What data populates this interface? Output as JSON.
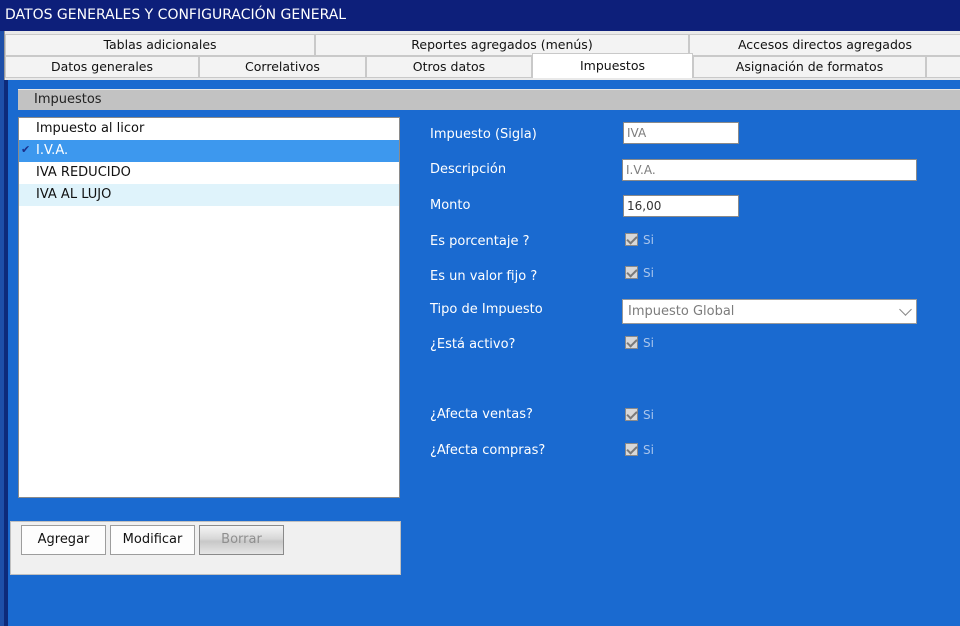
{
  "window": {
    "title": "DATOS GENERALES Y CONFIGURACIÓN GENERAL"
  },
  "tabs": {
    "row1": [
      {
        "label": "Tablas adicionales"
      },
      {
        "label": "Reportes agregados (menús)"
      },
      {
        "label": "Accesos directos agregados"
      }
    ],
    "row2": [
      {
        "label": "Datos generales"
      },
      {
        "label": "Correlativos"
      },
      {
        "label": "Otros datos"
      },
      {
        "label": "Impuestos"
      },
      {
        "label": "Asignación de formatos"
      }
    ],
    "active": "Impuestos"
  },
  "section": {
    "title": "Impuestos"
  },
  "taxes_list": {
    "items": [
      {
        "label": "Impuesto al licor",
        "selected": false
      },
      {
        "label": "I.V.A.",
        "selected": true
      },
      {
        "label": "IVA REDUCIDO",
        "selected": false
      },
      {
        "label": "IVA AL LUJO",
        "selected": false
      }
    ],
    "selected_marker_icon": "checkmark-icon"
  },
  "buttons": {
    "add": "Agregar",
    "modify": "Modificar",
    "delete": "Borrar"
  },
  "form": {
    "sigla": {
      "label": "Impuesto (Sigla)",
      "value": "IVA"
    },
    "descripcion": {
      "label": "Descripción",
      "value": "I.V.A."
    },
    "monto": {
      "label": "Monto",
      "value": "16,00"
    },
    "es_porcentaje": {
      "label": "Es porcentaje ?",
      "checked": true,
      "text": "Si"
    },
    "es_valor_fijo": {
      "label": "Es un valor  fijo ?",
      "checked": true,
      "text": "Si"
    },
    "tipo": {
      "label": "Tipo de Impuesto",
      "value": "Impuesto Global"
    },
    "activo": {
      "label": "¿Está activo?",
      "checked": true,
      "text": "Si"
    },
    "afecta_ventas": {
      "label": "¿Afecta ventas?",
      "checked": true,
      "text": "Si"
    },
    "afecta_compras": {
      "label": "¿Afecta compras?",
      "checked": true,
      "text": "Si"
    }
  },
  "colors": {
    "title_bar": "#0d1f7a",
    "content_bg": "#1a6ad0",
    "selected_row": "#3d98ee",
    "alt_row": "#dff3fb"
  }
}
